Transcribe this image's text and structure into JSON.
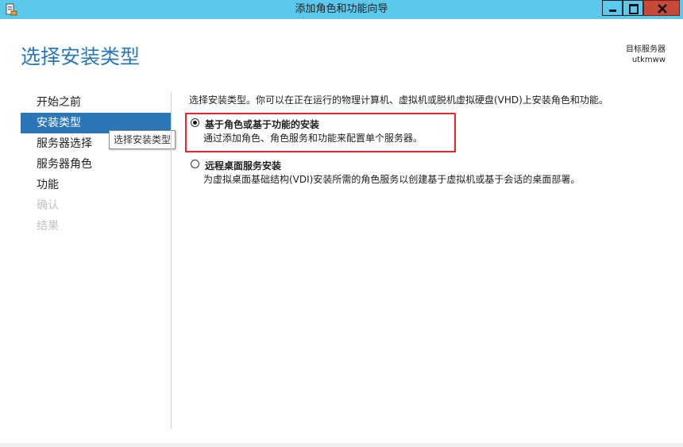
{
  "window": {
    "title": "添加角色和功能向导"
  },
  "header": {
    "title": "选择安装类型",
    "target_label": "目标服务器",
    "target_server": "utkmww"
  },
  "nav": {
    "items": [
      {
        "label": "开始之前"
      },
      {
        "label": "安装类型"
      },
      {
        "label": "服务器选择"
      },
      {
        "label": "服务器角色"
      },
      {
        "label": "功能"
      },
      {
        "label": "确认"
      },
      {
        "label": "结果"
      }
    ],
    "tooltip": "选择安装类型"
  },
  "main": {
    "description": "选择安装类型。你可以在正在运行的物理计算机、虚拟机或脱机虚拟硬盘(VHD)上安装角色和功能。",
    "options": [
      {
        "title": "基于角色或基于功能的安装",
        "description": "通过添加角色、角色服务和功能来配置单个服务器。",
        "selected": true
      },
      {
        "title": "远程桌面服务安装",
        "description": "为虚拟桌面基础结构(VDI)安装所需的角色服务以创建基于虚拟机或基于会话的桌面部署。",
        "selected": false
      }
    ]
  },
  "colors": {
    "titlebar": "#5cc8ec",
    "accent": "#2b77b6",
    "highlight": "#e3262f",
    "close": "#c7493a"
  }
}
